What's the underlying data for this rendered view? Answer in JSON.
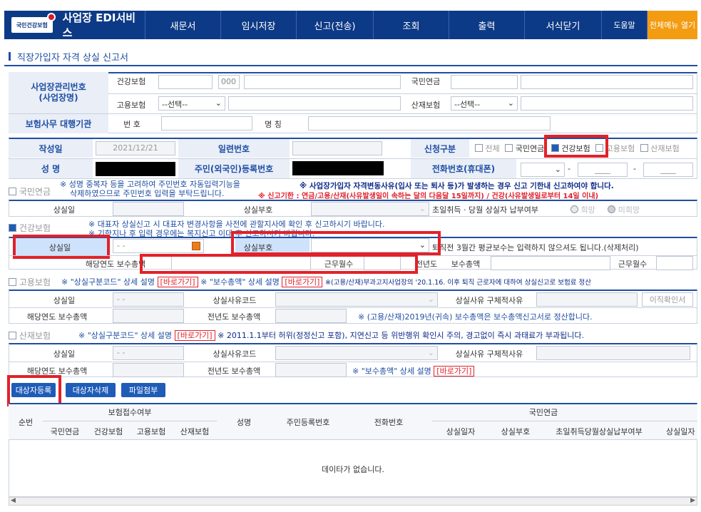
{
  "header": {
    "logo_text": "국민건강보험",
    "app_title": "사업장 EDI서비스",
    "nav": [
      "새문서",
      "임시저장",
      "신고(전송)",
      "조회",
      "출력",
      "서식닫기"
    ],
    "help": "도움말",
    "all_menu": "전체메뉴 열기"
  },
  "page_title": "직장가입자 자격 상실 신고서",
  "biz": {
    "label": "사업장관리번호\n(사업장명)",
    "health": "건강보험",
    "health_val": "000",
    "pension": "국민연금",
    "employ": "고용보험",
    "employ_select": "--선택--",
    "industrial": "산재보험",
    "industrial_select": "--선택--",
    "agency_label": "보험사무 대행기관",
    "agency_no": "번 호",
    "agency_name": "명 칭"
  },
  "form": {
    "written_label": "작성일",
    "written_val": "2021/12/21",
    "serial_label": "일련번호",
    "apply_label": "신청구분",
    "apply_opts": [
      "전체",
      "국민연금",
      "건강보험",
      "고용보험",
      "산재보험"
    ],
    "name_label": "성   명",
    "rrn_label": "주민(외국인)등록번호",
    "phone_label": "전화번호(휴대폰)",
    "phone_sep1": "-",
    "phone_sep2": "-",
    "phone_mid": "____",
    "phone_last": "____"
  },
  "pension": {
    "title": "국민연금",
    "note1": "※ 성명 중복자 등을 고려하여 주민번호 자동입력기능을",
    "note1b": "삭제하였으므로 주민번호 입력을 부탁드립니다.",
    "note2": "※ 사업장가입자 자격변동사유(입사 또는 퇴사 등)가 발생하는 경우 신고 기한내 신고하여야 합니다.",
    "note3": "※ 신고기한 : 연금/고용/산재(사유발생일이 속하는 달의 다음달 15일까지) / 건강(사유발생일로부터 14일 이내)",
    "loss_date": "상실일",
    "loss_code": "상실부호",
    "pay_label": "초일취득 · 당월 상실자 납부여부",
    "opt_yes": "희망",
    "opt_no": "미희망"
  },
  "health": {
    "title": "건강보험",
    "note1": "※ 대표자 상실신고 시 대표자 변경사항을 사전에 관할지사에 확인 후 신고하시기 바랍니다.",
    "note2": "※ 기한지나 후 입력 경우에는 복지신고 이대 후 신고하시기 바랍니다.",
    "loss_date": "상실일",
    "date_val": "-  -",
    "loss_code": "상실부호",
    "note3": "퇴직전 3월간 평균보수는 입력하지 않으셔도 됩니다.(삭제처리)",
    "year_total": "해당연도 보수총액",
    "year_months": "근무월수",
    "prev_label": "전년도",
    "prev_total": "보수총액",
    "prev_months": "근무월수"
  },
  "employment": {
    "title": "고용보험",
    "note1": "※ \"상실구분코드\" 상세 설명",
    "link": "[바로가기]",
    "note2": "※ \"보수총액\" 상세 설명",
    "note3": "※(고용/산재)부과고지사업장의 '20.1.16. 이후 퇴직 근로자에 대하여 상실신고로 보험료 정산",
    "loss_date": "상실일",
    "date_val": "-  -",
    "reason_code": "상실사유코드",
    "reason_detail": "상실사유 구체적사유",
    "confirm_btn": "이직확인서",
    "year_total": "해당연도 보수총액",
    "prev_total": "전년도 보수총액",
    "note4": "※ (고용/산재)2019년(귀속) 보수총액은 보수총액신고서로 정산합니다."
  },
  "industrial": {
    "title": "산재보험",
    "note1": "※ \"상실구분코드\" 상세 설명",
    "link": "[바로가기]",
    "note2": "※ 2011.1.1부터 허위(정정신고 포함), 지연신고 등 위반행위 확인시 주의, 경고없이 즉시 과태료가 부과됩니다.",
    "loss_date": "상실일",
    "date_val": "-  -",
    "reason_code": "상실사유코드",
    "reason_detail": "상실사유 구체적사유",
    "year_total": "해당연도 보수총액",
    "prev_total": "전년도 보수총액",
    "note3": "※ \"보수총액\" 상세 설명",
    "link2": "[바로가기]"
  },
  "buttons": {
    "register": "대상자등록",
    "delete": "대상자삭제",
    "attach": "파일첨부"
  },
  "list": {
    "h_no": "순번",
    "h_receipt": "보험접수여부",
    "h_sub": [
      "국민연금",
      "건강보험",
      "고용보험",
      "산재보험"
    ],
    "h_name": "성명",
    "h_rrn": "주민등록번호",
    "h_phone": "전화번호",
    "h_pension": "국민연금",
    "h_pen_sub": [
      "상실일자",
      "상실부호",
      "초일취득당월상실납부여부",
      "상실일자"
    ],
    "empty": "데이타가 없습니다."
  }
}
